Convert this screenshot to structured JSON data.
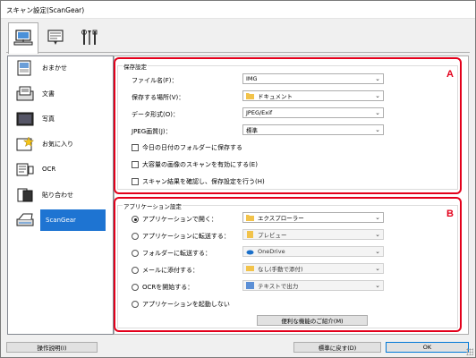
{
  "window": {
    "title": "スキャン設定(ScanGear)"
  },
  "tabs": [
    {
      "icon": "scan-from-computer-icon",
      "active": true
    },
    {
      "icon": "scan-from-panel-icon",
      "active": false
    },
    {
      "icon": "general-settings-icon",
      "active": false
    }
  ],
  "sidebar": {
    "items": [
      {
        "label": "おまかせ",
        "icon": "auto-scan-icon"
      },
      {
        "label": "文書",
        "icon": "document-icon"
      },
      {
        "label": "写真",
        "icon": "photo-icon"
      },
      {
        "label": "お気に入り",
        "icon": "favorites-icon"
      },
      {
        "label": "OCR",
        "icon": "ocr-icon"
      },
      {
        "label": "貼り合わせ",
        "icon": "stitch-icon"
      },
      {
        "label": "ScanGear",
        "icon": "scangear-icon",
        "selected": true
      }
    ]
  },
  "save_settings": {
    "title": "保存設定",
    "marker": "A",
    "file_name": {
      "label": "ファイル名(F)：",
      "value": "IMG"
    },
    "save_in": {
      "label": "保存する場所(V)：",
      "value": "ドキュメント"
    },
    "data_format": {
      "label": "データ形式(O)：",
      "value": "JPEG/Exif"
    },
    "jpeg_quality": {
      "label": "JPEG画質(J)：",
      "value": "標準"
    },
    "checkboxes": [
      "今日の日付のフォルダーに保存する",
      "大容量の画像のスキャンを有効にする(E)",
      "スキャン結果を確認し、保存設定を行う(H)"
    ]
  },
  "app_settings": {
    "title": "アプリケーション設定",
    "marker": "B",
    "options": [
      {
        "label": "アプリケーションで開く：",
        "value": "エクスプローラー",
        "selected": true
      },
      {
        "label": "アプリケーションに転送する：",
        "value": "プレビュー",
        "selected": false
      },
      {
        "label": "フォルダーに転送する：",
        "value": "OneDrive",
        "selected": false
      },
      {
        "label": "メールに添付する：",
        "value": "なし(手動で添付)",
        "selected": false
      },
      {
        "label": "OCRを開始する：",
        "value": "テキストで出力",
        "selected": false
      },
      {
        "label": "アプリケーションを起動しない",
        "value": null,
        "selected": false
      }
    ],
    "more_functions_button": "便利な機能のご紹介(M)"
  },
  "footer": {
    "instructions_button": "操作説明(I)",
    "defaults_button": "標準に戻す(D)",
    "ok_button": "OK"
  },
  "colors": {
    "selection": "#1e74d2",
    "marker_red": "#e3001b"
  }
}
